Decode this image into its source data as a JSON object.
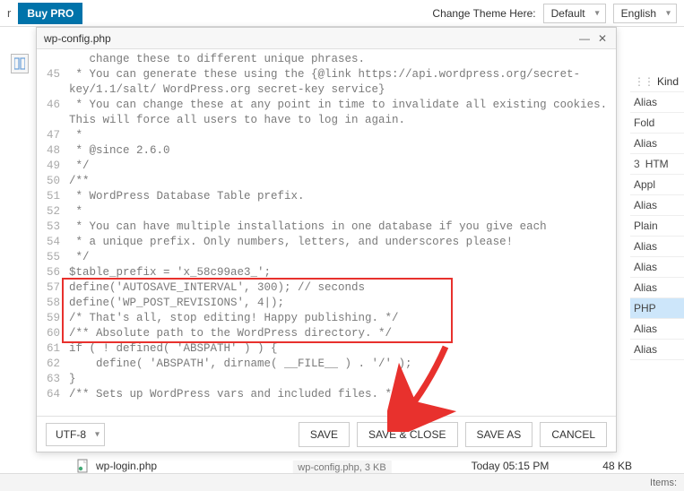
{
  "topbar": {
    "left_letter": "r",
    "buy_pro_label": "Buy PRO",
    "change_theme_label": "Change Theme Here:",
    "theme_value": "Default",
    "lang_value": "English"
  },
  "editor": {
    "title": "wp-config.php",
    "encoding": "UTF-8",
    "buttons": {
      "save": "SAVE",
      "save_close": "SAVE & CLOSE",
      "save_as": "SAVE AS",
      "cancel": "CANCEL"
    },
    "lines": [
      {
        "num": "",
        "text": "   change these to different unique phrases."
      },
      {
        "num": "45",
        "text": " * You can generate these using the {@link https://api.wordpress.org/secret-"
      },
      {
        "num": "",
        "text": "key/1.1/salt/ WordPress.org secret-key service}"
      },
      {
        "num": "46",
        "text": " * You can change these at any point in time to invalidate all existing cookies."
      },
      {
        "num": "",
        "text": "This will force all users to have to log in again."
      },
      {
        "num": "47",
        "text": " *"
      },
      {
        "num": "48",
        "text": " * @since 2.6.0"
      },
      {
        "num": "49",
        "text": " */"
      },
      {
        "num": "50",
        "text": "/**"
      },
      {
        "num": "51",
        "text": " * WordPress Database Table prefix."
      },
      {
        "num": "52",
        "text": " *"
      },
      {
        "num": "53",
        "text": " * You can have multiple installations in one database if you give each"
      },
      {
        "num": "54",
        "text": " * a unique prefix. Only numbers, letters, and underscores please!"
      },
      {
        "num": "55",
        "text": " */"
      },
      {
        "num": "56",
        "text": "$table_prefix = 'x_58c99ae3_';"
      },
      {
        "num": "57",
        "text": "define('AUTOSAVE_INTERVAL', 300); // seconds"
      },
      {
        "num": "58",
        "text": "define('WP_POST_REVISIONS', 4|);"
      },
      {
        "num": "59",
        "text": "/* That's all, stop editing! Happy publishing. */"
      },
      {
        "num": "60",
        "text": "/** Absolute path to the WordPress directory. */"
      },
      {
        "num": "61",
        "text": "if ( ! defined( 'ABSPATH' ) ) {"
      },
      {
        "num": "62",
        "text": "    define( 'ABSPATH', dirname( __FILE__ ) . '/' );"
      },
      {
        "num": "63",
        "text": "}"
      },
      {
        "num": "64",
        "text": "/** Sets up WordPress vars and included files. */"
      }
    ]
  },
  "file_pane": {
    "header": "Kind",
    "rows": [
      {
        "label": "Alias",
        "sel": false
      },
      {
        "label": "Fold",
        "sel": false
      },
      {
        "label": "Alias",
        "sel": false
      },
      {
        "label": "HTM",
        "sel": false,
        "badge": "3"
      },
      {
        "label": "Appl",
        "sel": false
      },
      {
        "label": "Alias",
        "sel": false
      },
      {
        "label": "Plain",
        "sel": false
      },
      {
        "label": "Alias",
        "sel": false
      },
      {
        "label": "Alias",
        "sel": false
      },
      {
        "label": "Alias",
        "sel": false
      },
      {
        "label": "PHP",
        "sel": true
      },
      {
        "label": "Alias",
        "sel": false
      },
      {
        "label": "Alias",
        "sel": false
      }
    ]
  },
  "bottom_file": {
    "name": "wp-login.php",
    "perm": "read",
    "date": "Today 05:15 PM",
    "size": "48 KB"
  },
  "status": {
    "center": "wp-config.php, 3 KB",
    "right": "Items:"
  }
}
